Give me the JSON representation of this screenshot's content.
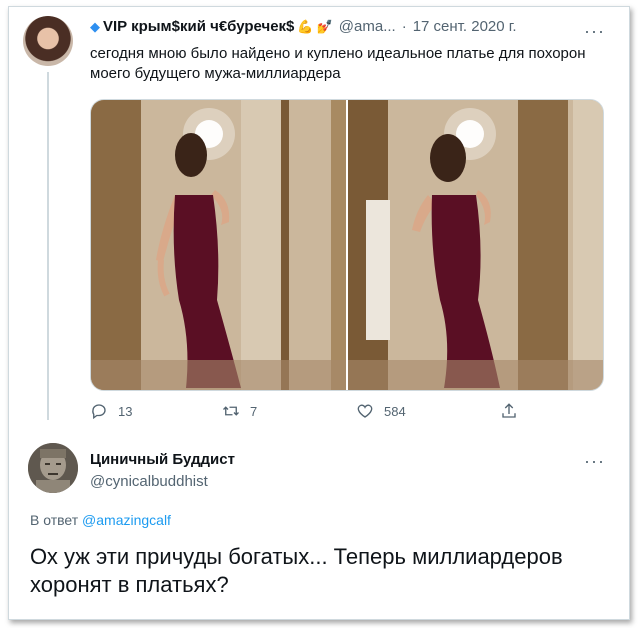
{
  "tweet1": {
    "name": "VIP крым$кий ч€буречек$",
    "name_emojis": [
      "💪",
      "💅"
    ],
    "handle": "@ama...",
    "date_separator": "·",
    "date": "17 сент. 2020 г.",
    "more_glyph": "···",
    "text": "сегодня мною было найдено и куплено идеальное платье для похорон моего будущего мужа-миллиардера",
    "photos": 2,
    "actions": {
      "reply_count": "13",
      "retweet_count": "7",
      "like_count": "584"
    }
  },
  "tweet2": {
    "name": "Циничный Буддист",
    "handle": "@cynicalbuddhist",
    "more_glyph": "···",
    "reply_prefix": "В ответ",
    "reply_handle": "@amazingcalf",
    "text": "Ох уж эти причуды богатых... Теперь миллиардеров хоронят в платьях?"
  },
  "colors": {
    "text": "#0f1419",
    "secondary": "#536471",
    "link": "#1d9bf0",
    "border": "#cfd9de",
    "dress": "#5a0f24"
  },
  "icons": [
    "verified-icon",
    "more-icon",
    "reply-icon",
    "retweet-icon",
    "like-icon",
    "share-icon"
  ]
}
